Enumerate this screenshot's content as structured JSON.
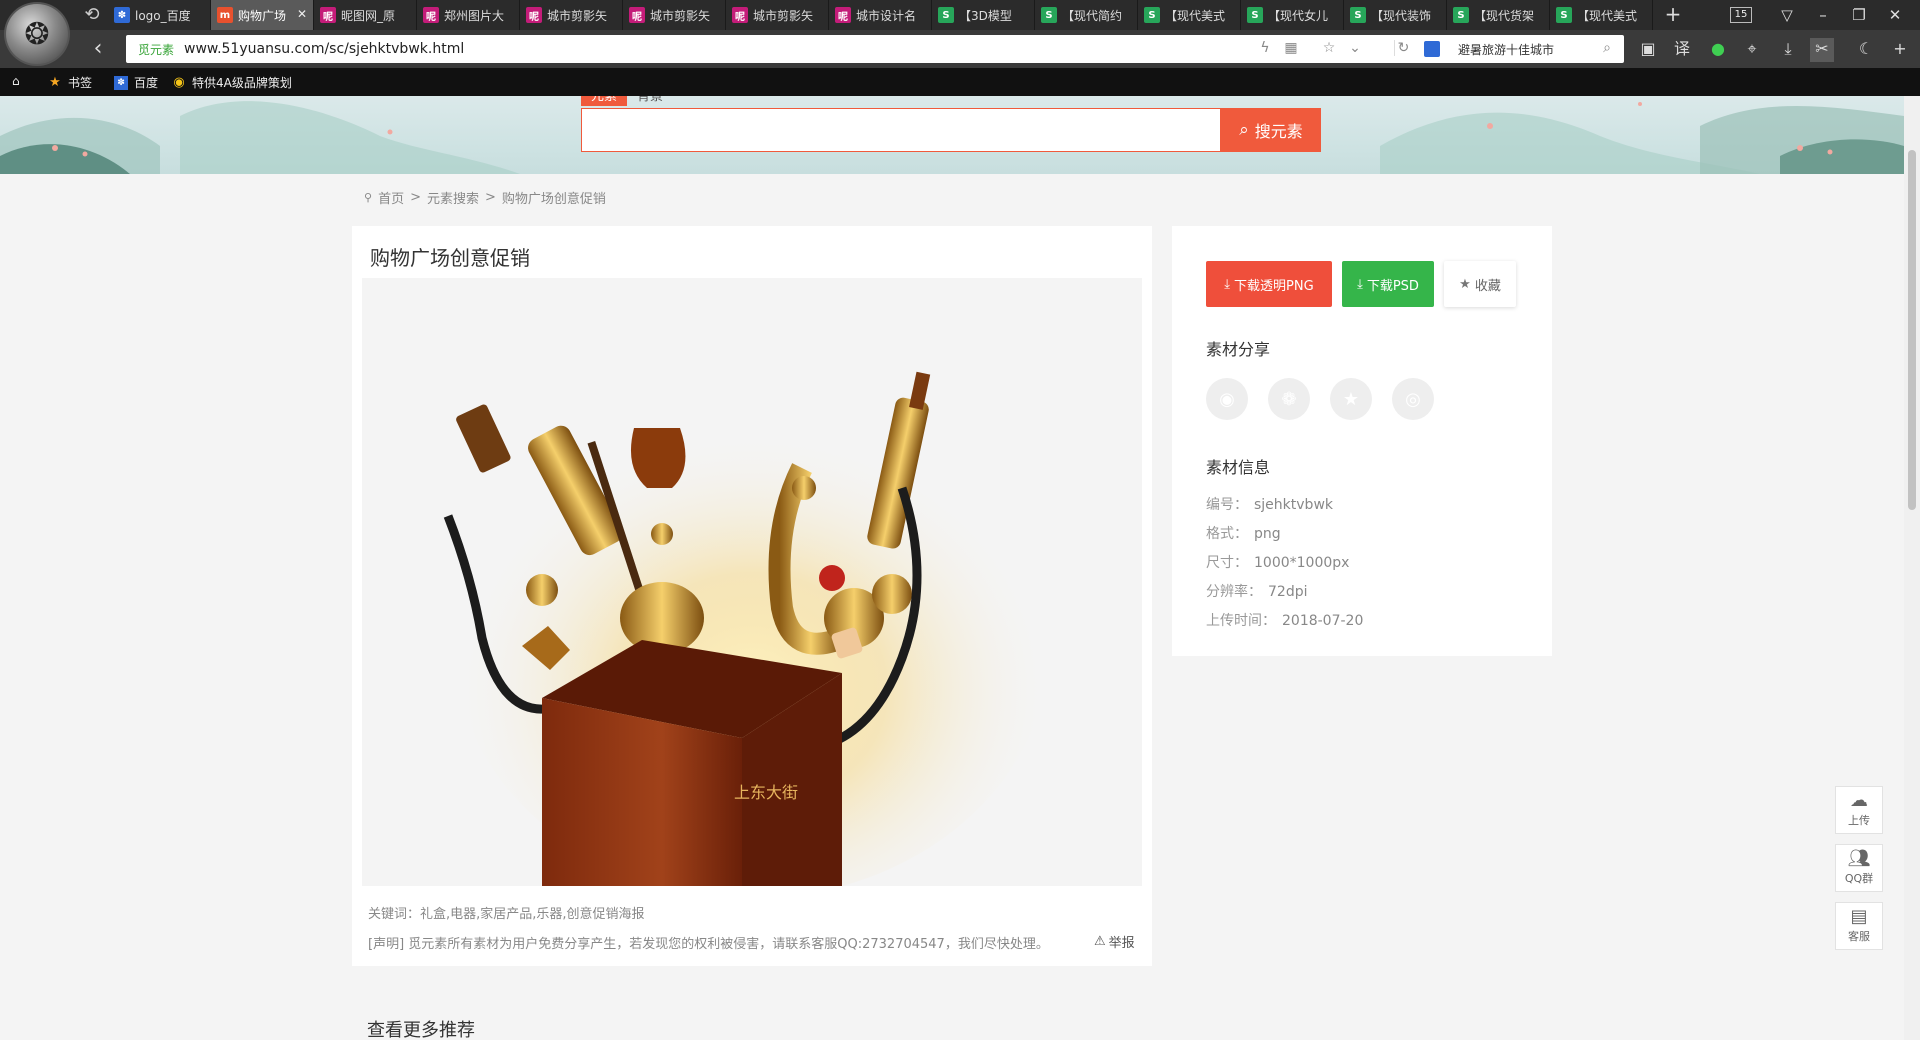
{
  "browser": {
    "tabs": [
      {
        "label": "logo_百度",
        "fav": "paw-icon",
        "color": "#2f6ad6"
      },
      {
        "label": "购物广场",
        "fav": "m-icon",
        "color": "#e8512e",
        "active": true
      },
      {
        "label": "昵图网_原",
        "fav": "ni-icon",
        "color": "#c41c79"
      },
      {
        "label": "郑州图片大",
        "fav": "ni-icon",
        "color": "#c41c79"
      },
      {
        "label": "城市剪影矢",
        "fav": "ni-icon",
        "color": "#c41c79"
      },
      {
        "label": "城市剪影矢",
        "fav": "ni-icon",
        "color": "#c41c79"
      },
      {
        "label": "城市剪影矢",
        "fav": "ni-icon",
        "color": "#c41c79"
      },
      {
        "label": "城市设计名",
        "fav": "ni-icon",
        "color": "#c41c79"
      },
      {
        "label": "【3D模型",
        "fav": "s-icon",
        "color": "#27a65a"
      },
      {
        "label": "【现代简约",
        "fav": "s-icon",
        "color": "#27a65a"
      },
      {
        "label": "【现代美式",
        "fav": "s-icon",
        "color": "#27a65a"
      },
      {
        "label": "【现代女儿",
        "fav": "s-icon",
        "color": "#27a65a"
      },
      {
        "label": "【现代装饰",
        "fav": "s-icon",
        "color": "#27a65a"
      },
      {
        "label": "【现代货架",
        "fav": "s-icon",
        "color": "#27a65a"
      },
      {
        "label": "【现代美式",
        "fav": "s-icon",
        "color": "#27a65a"
      }
    ],
    "tab_count": "15",
    "site_badge": "觅元素",
    "url": "www.51yuansu.com/sc/sjehktvbwk.html",
    "search_suggestion": "避暑旅游十佳城市",
    "bookmarks": [
      "书签",
      "百度",
      "特供4A级品牌策划"
    ]
  },
  "search": {
    "tabs": [
      "元素",
      "背景"
    ],
    "button": "搜元素",
    "placeholder": ""
  },
  "breadcrumb": [
    "首页",
    ">",
    "元素搜索",
    ">",
    "购物广场创意促销"
  ],
  "main": {
    "title": "购物广场创意促销",
    "keywords": "关键词：礼盒,电器,家居产品,乐器,创意促销海报",
    "disclaimer": "[声明] 觅元素所有素材为用户免费分享产生，若发现您的权利被侵害，请联系客服QQ:2732704547，我们尽快处理。",
    "report": "举报",
    "box_text": "上东大街"
  },
  "side": {
    "btn_png": "下载透明PNG",
    "btn_psd": "下载PSD",
    "btn_fav": "收藏",
    "share_title": "素材分享",
    "info_title": "素材信息",
    "info": [
      {
        "label": "编号：",
        "value": "sjehktvbwk"
      },
      {
        "label": "格式：",
        "value": "png"
      },
      {
        "label": "尺寸：",
        "value": "1000*1000px"
      },
      {
        "label": "分辨率：",
        "value": "72dpi"
      },
      {
        "label": "上传时间：",
        "value": "2018-07-20"
      }
    ]
  },
  "more_title": "查看更多推荐",
  "float": [
    {
      "label": "上传",
      "icon": "cloud-upload-icon"
    },
    {
      "label": "QQ群",
      "icon": "group-icon"
    },
    {
      "label": "客服",
      "icon": "chat-icon"
    }
  ]
}
